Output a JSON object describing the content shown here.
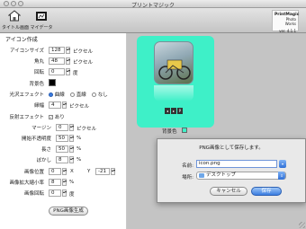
{
  "window": {
    "title": "プリントマジック"
  },
  "toolbar": {
    "items": [
      {
        "label": "タイトル画面",
        "icon": "home-icon"
      },
      {
        "label": "マイデータ",
        "icon": "folder-icon"
      }
    ],
    "logo": {
      "line1": "PrintMagic",
      "line2": "Photo Works",
      "version": "ver. 4.1.1"
    }
  },
  "panel": {
    "section_title": "アイコン作成",
    "icon_size": {
      "label": "アイコンサイズ",
      "value": "128",
      "unit": "ピクセル"
    },
    "corner": {
      "label": "角丸",
      "value": "48",
      "unit": "ピクセル"
    },
    "rotation": {
      "label": "回転",
      "value": "0",
      "unit": "度"
    },
    "bg_color": {
      "label": "背景色",
      "color": "#000000"
    },
    "gloss": {
      "label": "光沢エフェクト",
      "options": [
        "曲線",
        "直線",
        "なし"
      ],
      "selected": 0
    },
    "border": {
      "label": "縁幅",
      "value": "4",
      "unit": "ピクセル"
    },
    "reflection": {
      "label": "反射エフェクト",
      "checkbox_label": "あり",
      "checked": true
    },
    "margin": {
      "label": "マージン",
      "value": "0",
      "unit": "ピクセル"
    },
    "start_opacity": {
      "label": "開始不透明度",
      "value": "50",
      "unit": "%"
    },
    "length": {
      "label": "長さ",
      "value": "50",
      "unit": "%"
    },
    "blur": {
      "label": "ぼかし",
      "value": "8",
      "unit": "%"
    },
    "position": {
      "label": "画像位置",
      "x_label": "X",
      "x_value": "0",
      "y_label": "Y",
      "y_value": "-21"
    },
    "scale": {
      "label": "画像拡大縮小率",
      "value": "8",
      "unit": "%"
    },
    "img_rotation": {
      "label": "画像回転",
      "value": "0",
      "unit": "度"
    },
    "generate_button": "PNG画像生成"
  },
  "preview": {
    "card_color": "#3ef0c8",
    "bg_label": "背景色",
    "mini_buttons": [
      "◂",
      "▸",
      "P"
    ]
  },
  "save_sheet": {
    "title": "PNG画像として保存します。",
    "name_label": "名前:",
    "name_value": "icon.png",
    "location_label": "場所:",
    "location_value": "デスクトップ",
    "cancel_label": "キャンセル",
    "save_label": "保存"
  }
}
